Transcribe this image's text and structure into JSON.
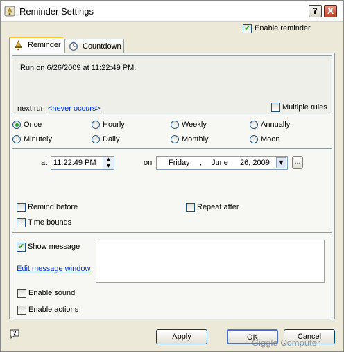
{
  "window": {
    "title": "Reminder Settings",
    "help_btn": "?",
    "close_btn": "X"
  },
  "enable_reminder": {
    "label": "Enable reminder",
    "checked": true
  },
  "tabs": [
    {
      "label": "Reminder",
      "active": true
    },
    {
      "label": "Countdown",
      "active": false
    }
  ],
  "summary": {
    "run_text": "Run on 6/26/2009 at 11:22:49 PM.",
    "next_run_label": "next run",
    "next_run_value": "<never occurs>",
    "multiple_rules": {
      "label": "Multiple rules",
      "checked": false
    }
  },
  "frequency": {
    "selected": "Once",
    "options": [
      "Once",
      "Hourly",
      "Weekly",
      "Annually",
      "Minutely",
      "Daily",
      "Monthly",
      "Moon"
    ]
  },
  "schedule": {
    "at_label": "at",
    "time": "11:22:49 PM",
    "on_label": "on",
    "date_day": "Friday",
    "date_sep": ",",
    "date_month": "June",
    "date_rest": "26, 2009",
    "ellipsis": "..."
  },
  "options": {
    "remind_before": {
      "label": "Remind before",
      "checked": false
    },
    "repeat_after": {
      "label": "Repeat after",
      "checked": false
    },
    "time_bounds": {
      "label": "Time bounds",
      "checked": false
    }
  },
  "message": {
    "show_message": {
      "label": "Show message",
      "checked": true
    },
    "edit_link": "Edit message window",
    "text": ""
  },
  "enable_sound": {
    "label": "Enable sound",
    "checked": false
  },
  "enable_actions": {
    "label": "Enable actions",
    "checked": false
  },
  "footer": {
    "apply": "Apply",
    "ok": "OK",
    "cancel": "Cancel",
    "watermark": "Giggle Computer"
  },
  "colors": {
    "accent": "#21a121",
    "link": "#0033cc",
    "tab_highlight": "#ffc83c"
  }
}
